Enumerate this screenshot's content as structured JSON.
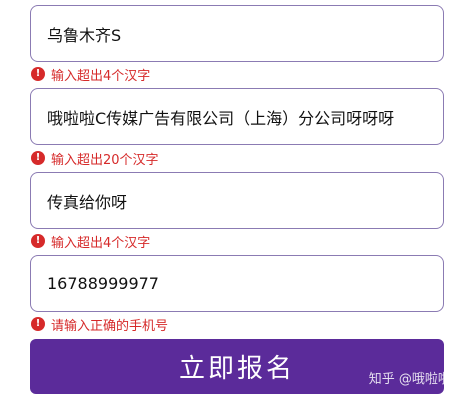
{
  "fields": [
    {
      "value": "乌鲁木齐S",
      "error": "输入超出4个汉字"
    },
    {
      "value": "哦啦啦C传媒广告有限公司（上海）分公司呀呀呀",
      "error": "输入超出20个汉字"
    },
    {
      "value": "传真给你呀",
      "error": "输入超出4个汉字"
    },
    {
      "value": "16788999977",
      "error": "请输入正确的手机号"
    }
  ],
  "submit_label": "立即报名",
  "watermark": "知乎 @哦啦啦C",
  "colors": {
    "error": "#d62a2a",
    "button": "#5b2b9a",
    "field_border": "#8b7bb3"
  },
  "icons": {
    "error": "exclamation-circle-icon"
  }
}
